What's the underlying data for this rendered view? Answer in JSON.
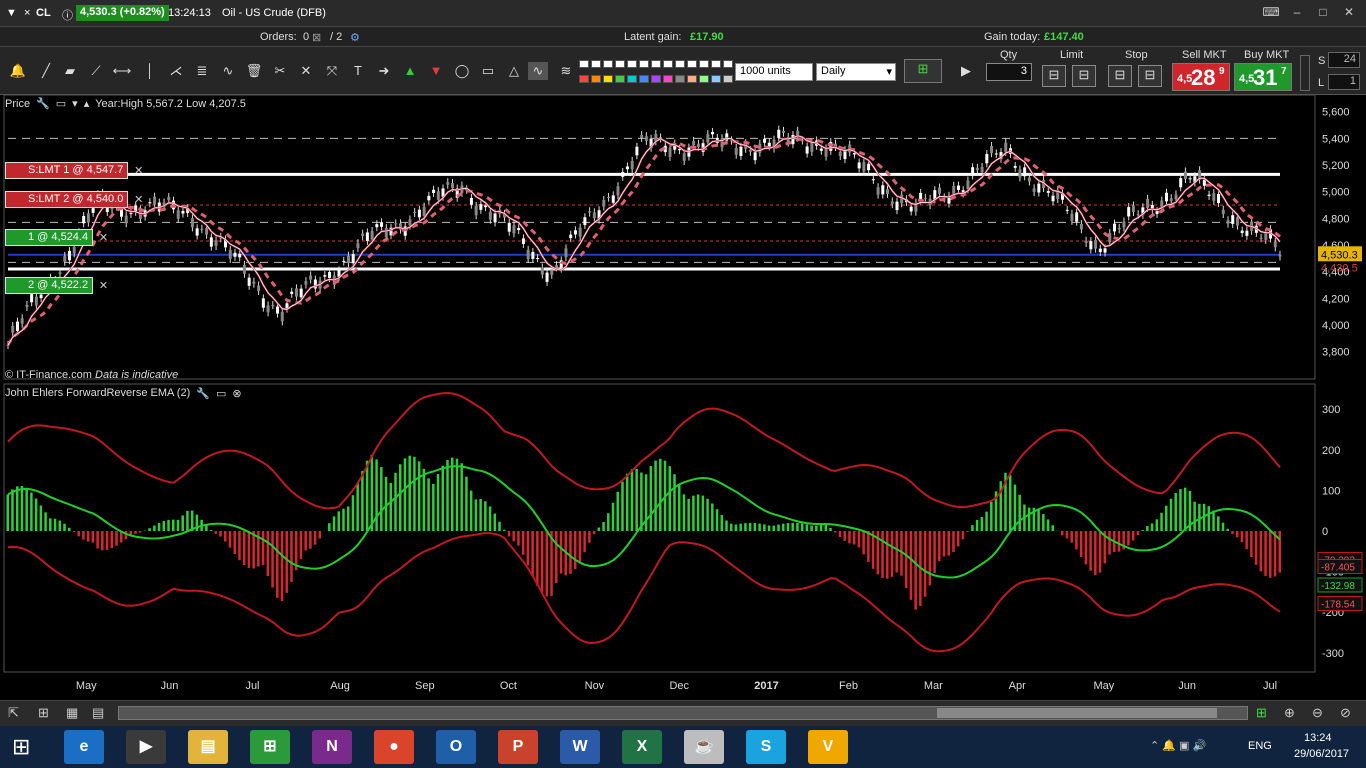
{
  "titlebar": {
    "symbol": "CL",
    "price": "4,530.3 (+0.82%)",
    "time": "13:24:13",
    "instrument": "Oil - US Crude (DFB)"
  },
  "orderbar": {
    "orders_label": "Orders:",
    "orders_value": "0",
    "orders_total": "/ 2",
    "latent_label": "Latent gain:",
    "latent_value": "£17.90",
    "today_label": "Gain today:",
    "today_value": "£147.40"
  },
  "toolbar": {
    "units": "1000 units",
    "timeframe": "Daily",
    "qty_label": "Qty",
    "qty_value": "3",
    "limit_label": "Limit",
    "stop_label": "Stop",
    "sell_label": "Sell MKT",
    "buy_label": "Buy MKT",
    "sell_prefix": "4,5",
    "sell_big": "28",
    "sell_sup": "9",
    "buy_prefix": "4,5",
    "buy_big": "31",
    "buy_sup": "7",
    "s_label": "S",
    "s_value": "24",
    "l_label": "L",
    "l_value": "1"
  },
  "price_panel": {
    "title": "Price",
    "range": "Year:High 5,567.2 Low 4,207.5",
    "copyright": "© IT-Finance.com",
    "note": "Data is indicative"
  },
  "orders": [
    {
      "label": "S:LMT  1 @ 4,547.7",
      "color": "#c0282d"
    },
    {
      "label": "S:LMT  2 @ 4,540.0",
      "color": "#c0282d"
    },
    {
      "label": "1 @ 4,524.4",
      "color": "#1f9a2a"
    },
    {
      "label": "2 @ 4,522.2",
      "color": "#1f9a2a"
    }
  ],
  "indicator_panel": {
    "title": "John Ehlers ForwardReverse EMA (2)"
  },
  "chart_data": [
    {
      "type": "line",
      "title": "Oil - US Crude (DFB)",
      "x": [
        "May",
        "Jun",
        "Jul",
        "Aug",
        "Sep",
        "Oct",
        "Nov",
        "Dec",
        "2017",
        "Feb",
        "Mar",
        "Apr",
        "May",
        "Jun",
        "Jul"
      ],
      "series": [
        {
          "values": [
            3850,
            4900,
            4850,
            4100,
            4650,
            5050,
            4400,
            5350,
            5350,
            5380,
            4850,
            5300,
            4600,
            5100,
            4530
          ]
        }
      ],
      "y_ticks": [
        "5,600",
        "5,400",
        "5,200",
        "5,000",
        "4,800",
        "4,600",
        "4,400",
        "4,200",
        "4,000",
        "3,800"
      ],
      "ylim": [
        3700,
        5650
      ],
      "current": "4,530.3",
      "marker_red": "4,430.5"
    },
    {
      "type": "bar",
      "title": "John Ehlers ForwardReverse EMA (2)",
      "y_ticks": [
        "300",
        "200",
        "100",
        "0",
        "-100",
        "-200",
        "-300"
      ],
      "ylim": [
        -330,
        330
      ],
      "values": [
        150,
        -60,
        60,
        -180,
        190,
        180,
        -200,
        220,
        20,
        20,
        -200,
        150,
        -120,
        130,
        -160
      ],
      "labels": [
        "-70.292",
        "-87.405",
        "-132.98",
        "-178.54"
      ]
    }
  ],
  "scroll": {
    "icons": [
      "pin-icon",
      "fullscreen-icon",
      "grid-icon"
    ]
  },
  "taskbar": {
    "lang": "ENG",
    "time": "13:24",
    "date": "29/06/2017",
    "apps": [
      {
        "name": "ie",
        "label": "e",
        "color": "#1a6fc4"
      },
      {
        "name": "media",
        "label": "▶",
        "color": "#3a3a3a"
      },
      {
        "name": "explorer",
        "label": "▤",
        "color": "#e3b43a"
      },
      {
        "name": "store",
        "label": "⊞",
        "color": "#2a9a3a"
      },
      {
        "name": "onenote",
        "label": "N",
        "color": "#7a2a8a"
      },
      {
        "name": "chrome",
        "label": "●",
        "color": "#d9442b"
      },
      {
        "name": "outlook",
        "label": "O",
        "color": "#1f5fa8"
      },
      {
        "name": "powerpoint",
        "label": "P",
        "color": "#c9422b"
      },
      {
        "name": "word",
        "label": "W",
        "color": "#2a5aa8"
      },
      {
        "name": "excel",
        "label": "X",
        "color": "#217346"
      },
      {
        "name": "java",
        "label": "☕",
        "color": "#bdbdbd"
      },
      {
        "name": "skype",
        "label": "S",
        "color": "#1aa3df"
      },
      {
        "name": "vlc",
        "label": "V",
        "color": "#f0a800"
      }
    ]
  }
}
